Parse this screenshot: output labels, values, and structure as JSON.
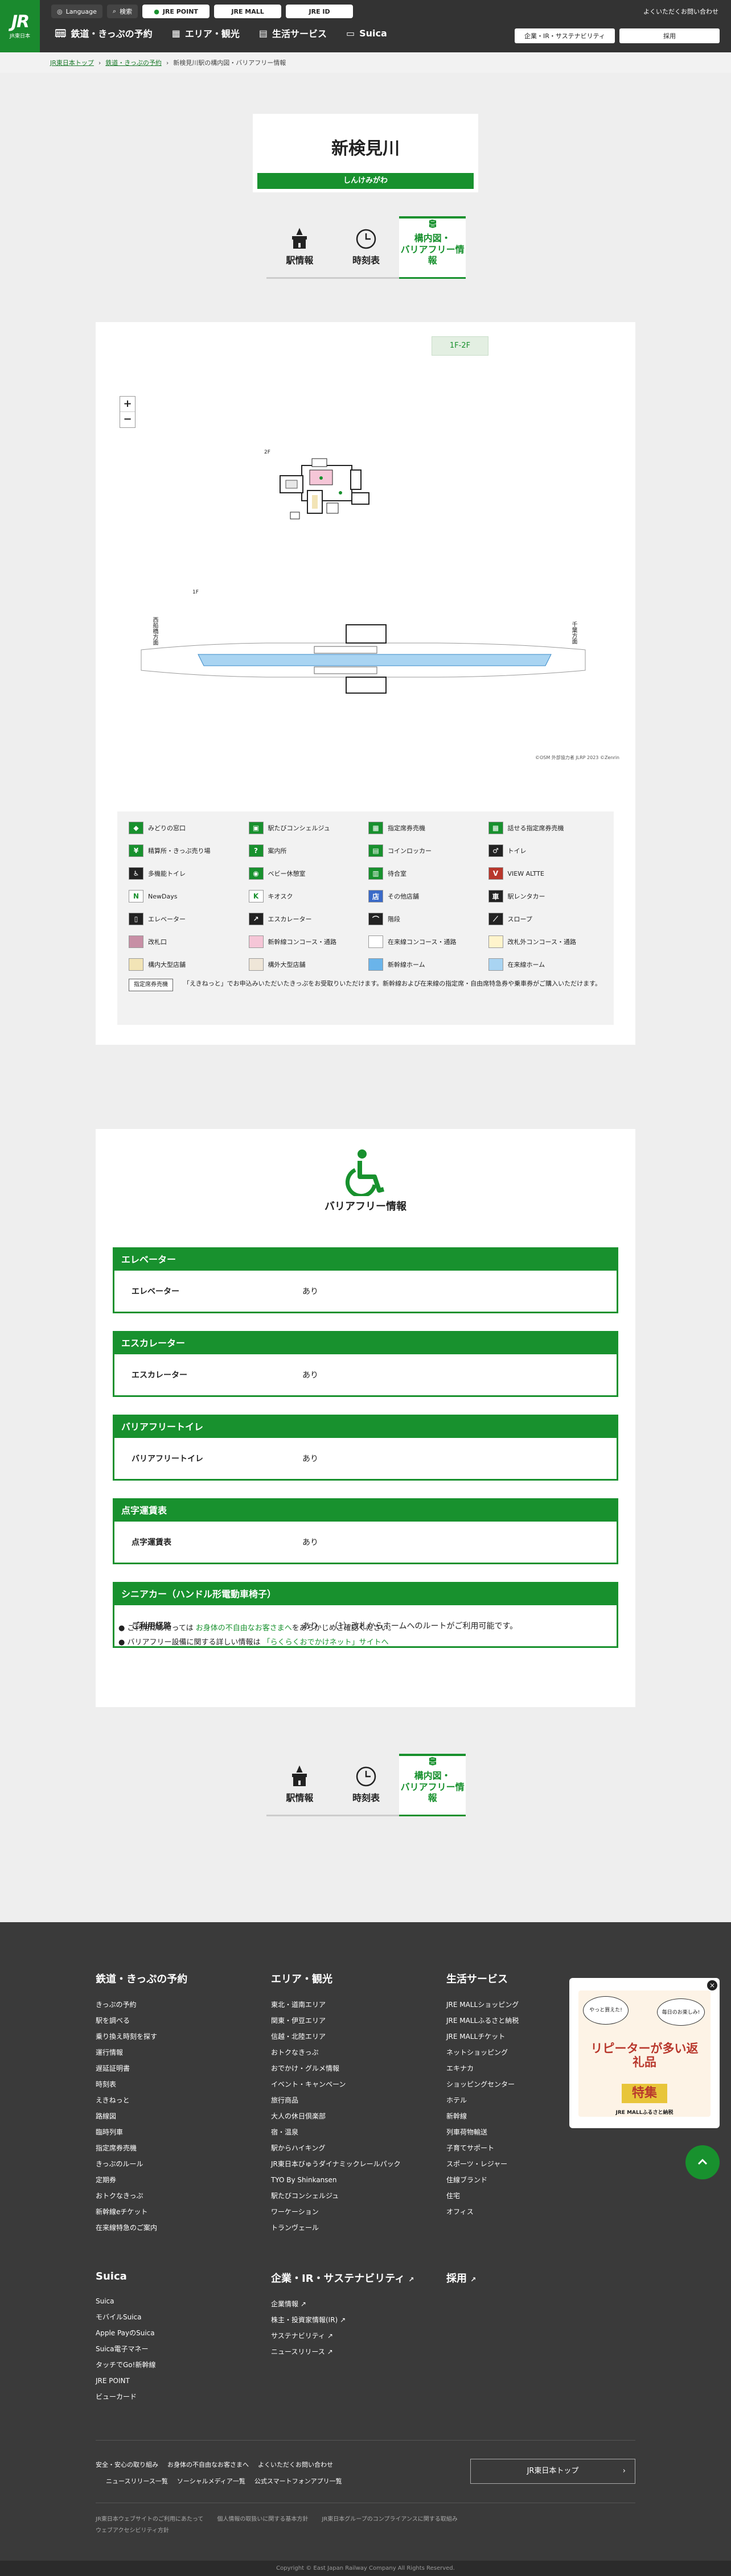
{
  "header": {
    "logo_main": "JR",
    "logo_sub": "JR東日本",
    "language": "Language",
    "search": "検索",
    "jre_point": "JRE POINT",
    "jre_mall": "JRE MALL",
    "jre_id": "JRE ID",
    "faq": "よくいただくお問い合わせ",
    "nav": [
      "鉄道・きっぷの予約",
      "エリア・観光",
      "生活サービス",
      "Suica"
    ],
    "corp": "企業・IR・サステナビリティ",
    "recruit": "採用"
  },
  "breadcrumb": [
    "JR東日本トップ",
    "鉄道・きっぷの予約",
    "新検見川駅の構内図・バリアフリー情報"
  ],
  "station": {
    "name": "新検見川",
    "kana": "しんけみがわ"
  },
  "tabs": {
    "info": "駅情報",
    "timetable": "時刻表",
    "map": "構内図・\nバリアフリー情報"
  },
  "map": {
    "floor": "1F-2F",
    "zoom_in": "+",
    "zoom_out": "−",
    "label_2f": "2F",
    "label_1f": "1F",
    "toward_left": "西船橋方面",
    "toward_right": "千葉方面",
    "attribution": "©OSM 外部協力者 JLRP 2023 ©Zenrin"
  },
  "legend": {
    "items": [
      "みどりの窓口",
      "駅たびコンシェルジュ",
      "指定席券売機",
      "話せる指定席券売機",
      "精算所・きっぷ売り場",
      "案内所",
      "コインロッカー",
      "トイレ",
      "多機能トイレ",
      "ベビー休憩室",
      "待合室",
      "VIEW ALTTE",
      "NewDays",
      "キオスク",
      "その他店舗",
      "駅レンタカー",
      "エレベーター",
      "エスカレーター",
      "階段",
      "スロープ",
      "改札口",
      "新幹線コンコース・通路",
      "在来線コンコース・通路",
      "改札外コンコース・通路",
      "構内大型店舗",
      "構外大型店舗",
      "新幹線ホーム",
      "在来線ホーム"
    ],
    "note_tag": "指定席券売機",
    "note_text": "「えきねっと」でお申込みいただいたきっぷをお受取りいただけます。新幹線および在来線の指定席・自由席特急券や乗車券がご購入いただけます。",
    "colors": {
      "green": "#18912e",
      "platform": "#a9d4f2",
      "concourse": "#f2e4b6",
      "pink": "#f5c6d7"
    }
  },
  "barrierfree": {
    "title": "バリアフリー情報",
    "sections": [
      {
        "header": "エレベーター",
        "key": "エレベーター",
        "value": "あり"
      },
      {
        "header": "エスカレーター",
        "key": "エスカレーター",
        "value": "あり"
      },
      {
        "header": "バリアフリートイレ",
        "key": "バリアフリートイレ",
        "value": "あり"
      },
      {
        "header": "点字運賃表",
        "key": "点字運賃表",
        "value": "あり"
      },
      {
        "header": "シニアカー（ハンドル形電動車椅子）",
        "key": "ご利用経路",
        "value": "あり　　（1）改札からホームへのルートがご利用可能です。"
      }
    ],
    "bullet1_pre": "ご利用にあたっては",
    "bullet1_link": "お身体の不自由なお客さまへ",
    "bullet1_post": "をあらかじめご確認ください。",
    "bullet2_pre": "バリアフリー設備に関する詳しい情報は",
    "bullet2_link": "「らくらくおでかけネット」サイトへ"
  },
  "footer": {
    "col1_title": "鉄道・きっぷの予約",
    "col1": [
      "きっぷの予約",
      "駅を調べる",
      "乗り換え時刻を探す",
      "運行情報",
      "遅延証明書",
      "時刻表",
      "えきねっと",
      "路線図",
      "臨時列車",
      "指定席券売機",
      "きっぷのルール",
      "定期券",
      "おトクなきっぷ",
      "新幹線eチケット",
      "在来線特急のご案内"
    ],
    "col2_title": "エリア・観光",
    "col2": [
      "東北・道南エリア",
      "関東・伊豆エリア",
      "信越・北陸エリア",
      "おトクなきっぷ",
      "おでかけ・グルメ情報",
      "イベント・キャンペーン",
      "旅行商品",
      "大人の休日倶楽部",
      "宿・温泉",
      "駅からハイキング",
      "JR東日本びゅうダイナミックレールパック",
      "TYO By Shinkansen",
      "駅たびコンシェルジュ",
      "ワーケーション",
      "トランヴェール"
    ],
    "col3_title": "生活サービス",
    "col3": [
      "JRE MALLショッピング",
      "JRE MALLふるさと納税",
      "JRE MALLチケット",
      "ネットショッピング",
      "エキナカ",
      "ショッピングセンター",
      "ホテル",
      "新幹線",
      "列車荷物輸送",
      "子育てサポート",
      "スポーツ・レジャー",
      "住線ブランド",
      "住宅",
      "オフィス"
    ],
    "suica_title": "Suica",
    "suica": [
      "Suica",
      "モバイルSuica",
      "Apple PayのSuica",
      "Suica電子マネー",
      "タッチでGo!新幹線",
      "JRE POINT",
      "ビューカード"
    ],
    "corp_title": "企業・IR・サステナビリティ",
    "corp": [
      "企業情報",
      "株主・投資家情報(IR)",
      "サステナビリティ",
      "ニュースリリース"
    ],
    "recruit_title": "採用",
    "bottom_links": [
      "安全・安心の取り組み",
      "お身体の不自由なお客さまへ",
      "よくいただくお問い合わせ"
    ],
    "bottom_links2": [
      "ニュースリリース一覧",
      "ソーシャルメディア一覧",
      "公式スマートフォンアプリ一覧"
    ],
    "top_button": "JR東日本トップ",
    "small_links": [
      "JR東日本ウェブサイトのご利用にあたって",
      "個人情報の取扱いに関する基本方針",
      "JR東日本グループのコンプライアンスに関する取組み",
      "ウェブアクセシビリティ方針"
    ],
    "copyright": "Copyright © East Japan Railway Company All Rights Reserved."
  },
  "ad": {
    "bubble1": "やっと買えた!",
    "bubble2": "毎日のお楽しみ!",
    "headline": "リピーターが多い返礼品",
    "tag": "特集",
    "brand": "JRE MALLふるさと納税"
  }
}
